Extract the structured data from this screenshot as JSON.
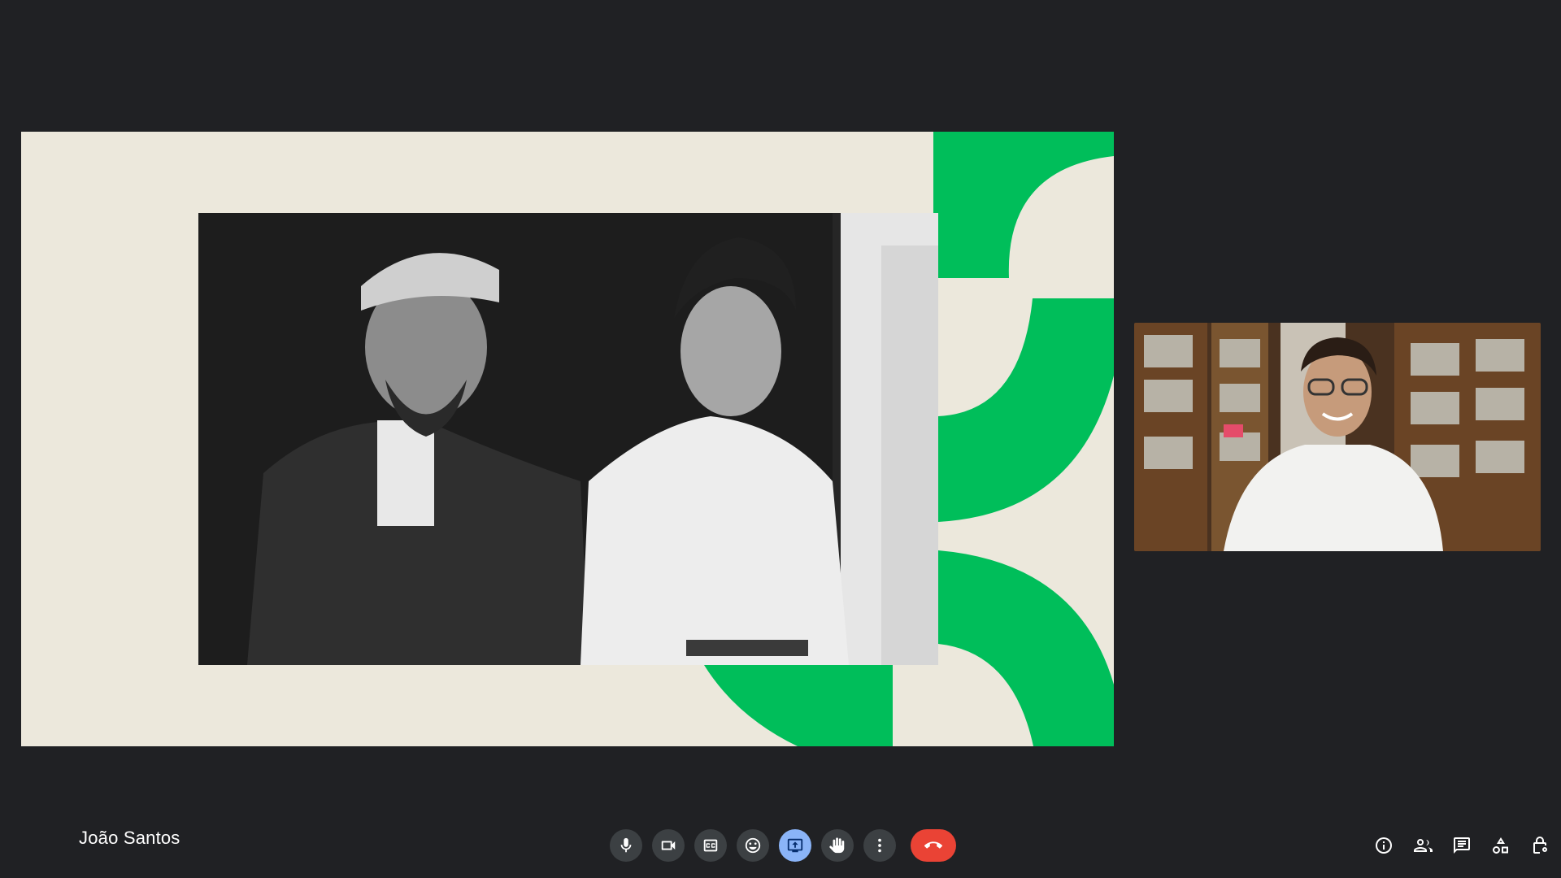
{
  "meeting": {
    "presenter_name": "João Santos"
  },
  "controls": {
    "primary": [
      {
        "name": "microphone-button",
        "icon": "mic-icon"
      },
      {
        "name": "camera-button",
        "icon": "videocam-icon"
      },
      {
        "name": "captions-button",
        "icon": "closed-captions-icon"
      },
      {
        "name": "reactions-button",
        "icon": "emoji-icon"
      },
      {
        "name": "present-button",
        "icon": "present-screen-icon",
        "active": true
      },
      {
        "name": "raise-hand-button",
        "icon": "hand-icon"
      },
      {
        "name": "more-options-button",
        "icon": "more-vert-icon"
      },
      {
        "name": "leave-call-button",
        "icon": "call-end-icon"
      }
    ],
    "secondary": [
      {
        "name": "meeting-details-button",
        "icon": "info-icon"
      },
      {
        "name": "people-button",
        "icon": "people-icon"
      },
      {
        "name": "chat-button",
        "icon": "chat-icon"
      },
      {
        "name": "activities-button",
        "icon": "shapes-icon"
      },
      {
        "name": "host-controls-button",
        "icon": "lock-person-icon"
      }
    ]
  },
  "colors": {
    "background": "#202124",
    "button": "#3c4043",
    "button_active": "#8ab4f8",
    "hangup": "#ea4335",
    "slide_background": "#ece8dc",
    "slide_accent": "#00be5a"
  }
}
